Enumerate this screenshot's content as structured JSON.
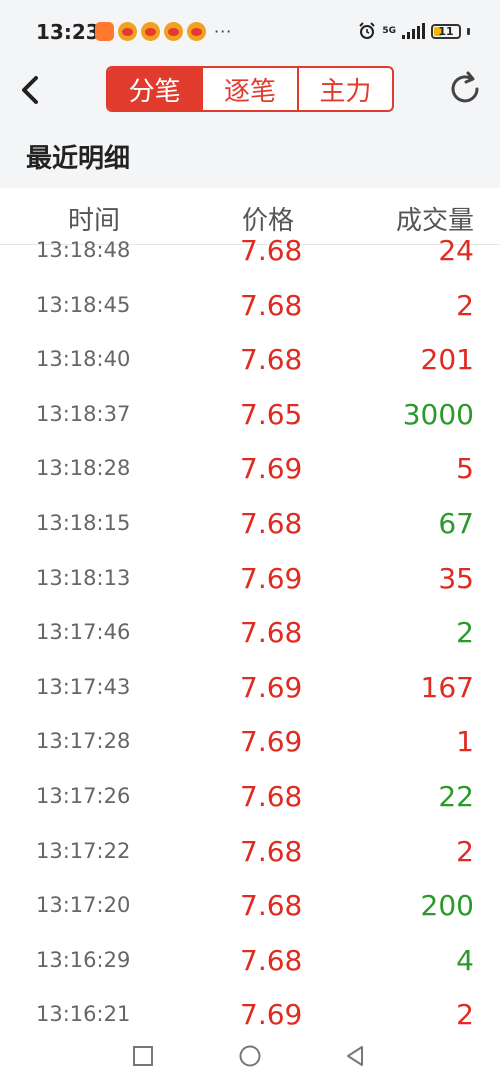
{
  "status_bar": {
    "time": "13:23",
    "more": "···",
    "network": "5G",
    "battery": "11"
  },
  "header": {
    "tabs": [
      {
        "label": "分笔",
        "active": true
      },
      {
        "label": "逐笔",
        "active": false
      },
      {
        "label": "主力",
        "active": false
      }
    ]
  },
  "section_title": "最近明细",
  "columns": {
    "time": "时间",
    "price": "价格",
    "volume": "成交量"
  },
  "rows": [
    {
      "time": "13:18:48",
      "price": "7.68",
      "volume": "24",
      "volume_color": "red"
    },
    {
      "time": "13:18:45",
      "price": "7.68",
      "volume": "2",
      "volume_color": "red"
    },
    {
      "time": "13:18:40",
      "price": "7.68",
      "volume": "201",
      "volume_color": "red"
    },
    {
      "time": "13:18:37",
      "price": "7.65",
      "volume": "3000",
      "volume_color": "green"
    },
    {
      "time": "13:18:28",
      "price": "7.69",
      "volume": "5",
      "volume_color": "red"
    },
    {
      "time": "13:18:15",
      "price": "7.68",
      "volume": "67",
      "volume_color": "green"
    },
    {
      "time": "13:18:13",
      "price": "7.69",
      "volume": "35",
      "volume_color": "red"
    },
    {
      "time": "13:17:46",
      "price": "7.68",
      "volume": "2",
      "volume_color": "green"
    },
    {
      "time": "13:17:43",
      "price": "7.69",
      "volume": "167",
      "volume_color": "red"
    },
    {
      "time": "13:17:28",
      "price": "7.69",
      "volume": "1",
      "volume_color": "red"
    },
    {
      "time": "13:17:26",
      "price": "7.68",
      "volume": "22",
      "volume_color": "green"
    },
    {
      "time": "13:17:22",
      "price": "7.68",
      "volume": "2",
      "volume_color": "red"
    },
    {
      "time": "13:17:20",
      "price": "7.68",
      "volume": "200",
      "volume_color": "green"
    },
    {
      "time": "13:16:29",
      "price": "7.68",
      "volume": "4",
      "volume_color": "green"
    },
    {
      "time": "13:16:21",
      "price": "7.69",
      "volume": "2",
      "volume_color": "red"
    }
  ],
  "colors": {
    "accent": "#e13b2e",
    "up": "#e02b20",
    "down": "#2a9a2a"
  }
}
